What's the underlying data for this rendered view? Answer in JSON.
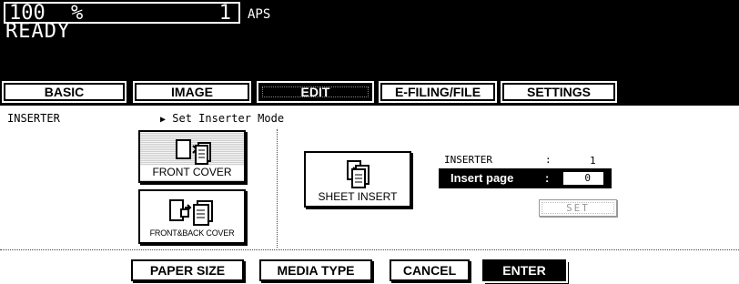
{
  "status": {
    "zoom_value": "100",
    "zoom_unit": "%",
    "copy_count": "1",
    "paper_mode": "APS",
    "state": "READY"
  },
  "tabs": [
    {
      "label": "BASIC",
      "active": false
    },
    {
      "label": "IMAGE",
      "active": false
    },
    {
      "label": "EDIT",
      "active": true
    },
    {
      "label": "E-FILING/FILE",
      "active": false
    },
    {
      "label": "SETTINGS",
      "active": false
    }
  ],
  "editor": {
    "section_label": "INSERTER",
    "mode_heading": "Set Inserter Mode",
    "front_cover_label": "FRONT COVER",
    "front_back_cover_label": "FRONT&BACK COVER",
    "sheet_insert_label": "SHEET INSERT",
    "inserter_label": "INSERTER",
    "inserter_colon": ":",
    "inserter_value": "1",
    "insert_page_label": "Insert page",
    "insert_page_colon": ":",
    "insert_page_value": "0",
    "set_label": "SET",
    "front_cover_icon": "front-cover-icon",
    "front_back_cover_icon": "front-back-cover-icon",
    "sheet_insert_icon": "sheet-insert-icon"
  },
  "footer": {
    "paper_size_label": "PAPER SIZE",
    "media_type_label": "MEDIA TYPE",
    "cancel_label": "CANCEL",
    "enter_label": "ENTER"
  },
  "colors": {
    "panel_bg": "#000000",
    "panel_text": "#ffffff",
    "disabled_text": "#999999"
  }
}
